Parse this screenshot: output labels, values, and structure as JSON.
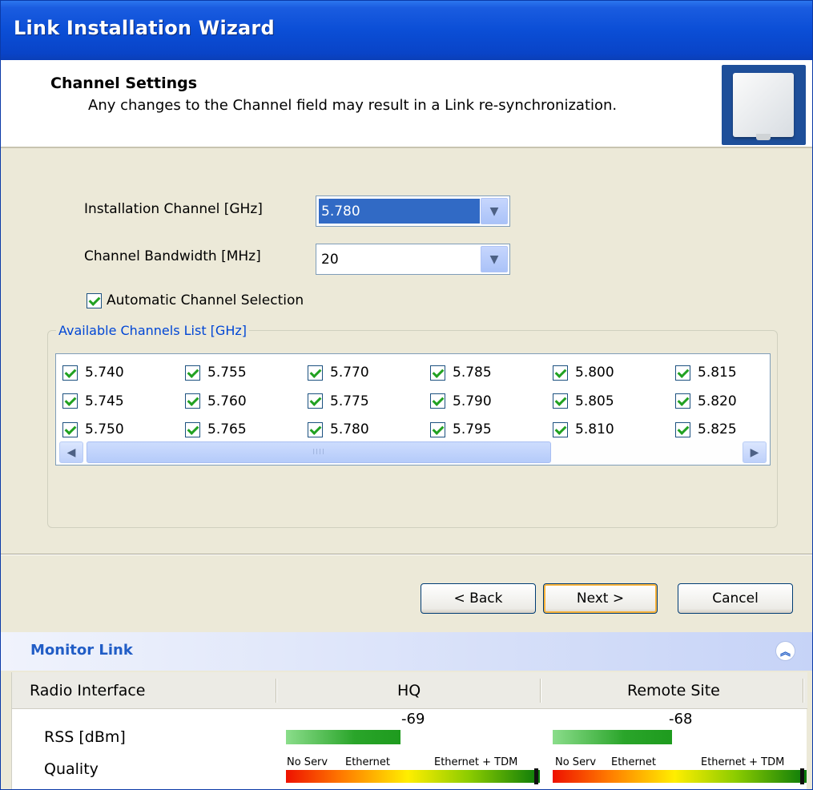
{
  "window": {
    "title": "Link Installation Wizard"
  },
  "header": {
    "title": "Channel Settings",
    "subtitle": "Any changes to the Channel field may result in a Link re-synchronization."
  },
  "form": {
    "installation_channel_label": "Installation Channel [GHz]",
    "installation_channel_value": "5.780",
    "channel_bandwidth_label": "Channel Bandwidth [MHz]",
    "channel_bandwidth_value": "20",
    "auto_selection_label": "Automatic Channel Selection",
    "auto_selection_checked": true
  },
  "channels": {
    "legend": "Available Channels List [GHz]",
    "items": [
      {
        "value": "5.740",
        "checked": true
      },
      {
        "value": "5.755",
        "checked": true
      },
      {
        "value": "5.770",
        "checked": true
      },
      {
        "value": "5.785",
        "checked": true
      },
      {
        "value": "5.800",
        "checked": true
      },
      {
        "value": "5.815",
        "checked": true
      },
      {
        "value": "5.745",
        "checked": true
      },
      {
        "value": "5.760",
        "checked": true
      },
      {
        "value": "5.775",
        "checked": true
      },
      {
        "value": "5.790",
        "checked": true
      },
      {
        "value": "5.805",
        "checked": true
      },
      {
        "value": "5.820",
        "checked": true
      },
      {
        "value": "5.750",
        "checked": true
      },
      {
        "value": "5.765",
        "checked": true
      },
      {
        "value": "5.780",
        "checked": true
      },
      {
        "value": "5.795",
        "checked": true
      },
      {
        "value": "5.810",
        "checked": true
      },
      {
        "value": "5.825",
        "checked": true
      }
    ]
  },
  "buttons": {
    "back": "< Back",
    "next": "Next >",
    "cancel": "Cancel"
  },
  "monitor": {
    "title": "Monitor Link",
    "columns": [
      "Radio Interface",
      "HQ",
      "Remote Site"
    ],
    "rows": {
      "rss": "RSS [dBm]",
      "quality": "Quality"
    },
    "hq": {
      "rss": "-69",
      "rss_level": 0.45
    },
    "remote": {
      "rss": "-68",
      "rss_level": 0.47
    },
    "quality_scale": {
      "low": "No Serv",
      "mid": "Ethernet",
      "high": "Ethernet + TDM"
    }
  },
  "icons": {
    "dropdown": "chevron-down-icon",
    "scroll_left": "arrow-left-icon",
    "scroll_right": "arrow-right-icon",
    "collapse": "double-chevron-up-icon",
    "product": "antenna-panel-icon"
  },
  "colors": {
    "title_bar": "#0b4ed6",
    "selection": "#316ac5",
    "legend_text": "#0046d5",
    "monitor_title": "#215dc6"
  }
}
